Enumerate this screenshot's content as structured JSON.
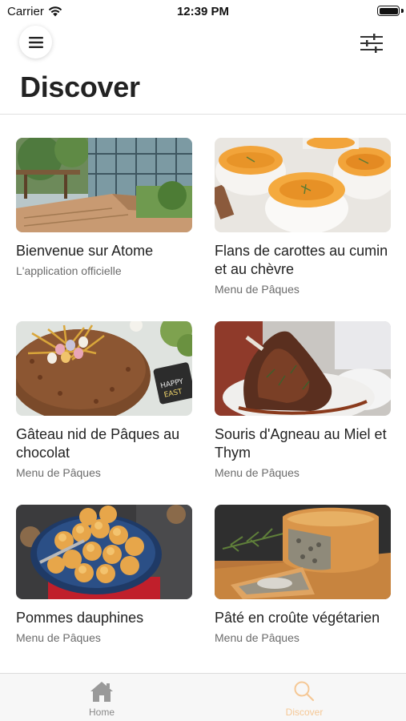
{
  "status_bar": {
    "carrier": "Carrier",
    "time": "12:39 PM"
  },
  "header": {
    "title": "Discover",
    "menu_icon": "hamburger-menu-icon",
    "filter_icon": "sliders-icon"
  },
  "cards": [
    {
      "title": "Bienvenue sur Atome",
      "subtitle": "L'application officielle",
      "image": "building-courtyard-photo"
    },
    {
      "title": "Flans de carottes au cumin et au chèvre",
      "subtitle": "Menu de Pâques",
      "image": "carrot-flans-photo"
    },
    {
      "title": "Gâteau nid de Pâques au chocolat",
      "subtitle": "Menu de Pâques",
      "image": "chocolate-nest-cake-photo"
    },
    {
      "title": "Souris d'Agneau au Miel et Thym",
      "subtitle": "Menu de Pâques",
      "image": "lamb-shank-photo"
    },
    {
      "title": "Pommes dauphines",
      "subtitle": "Menu de Pâques",
      "image": "pommes-dauphines-photo"
    },
    {
      "title": "Pâté en croûte végétarien",
      "subtitle": "Menu de Pâques",
      "image": "pate-en-croute-photo"
    }
  ],
  "tab_bar": {
    "tabs": [
      {
        "label": "Home",
        "icon": "home-icon",
        "active": false
      },
      {
        "label": "Discover",
        "icon": "search-icon",
        "active": true
      }
    ]
  },
  "colors": {
    "accent": "#f5c896",
    "inactive": "#888888",
    "title": "#222222",
    "subtitle": "#6b6b6b"
  }
}
